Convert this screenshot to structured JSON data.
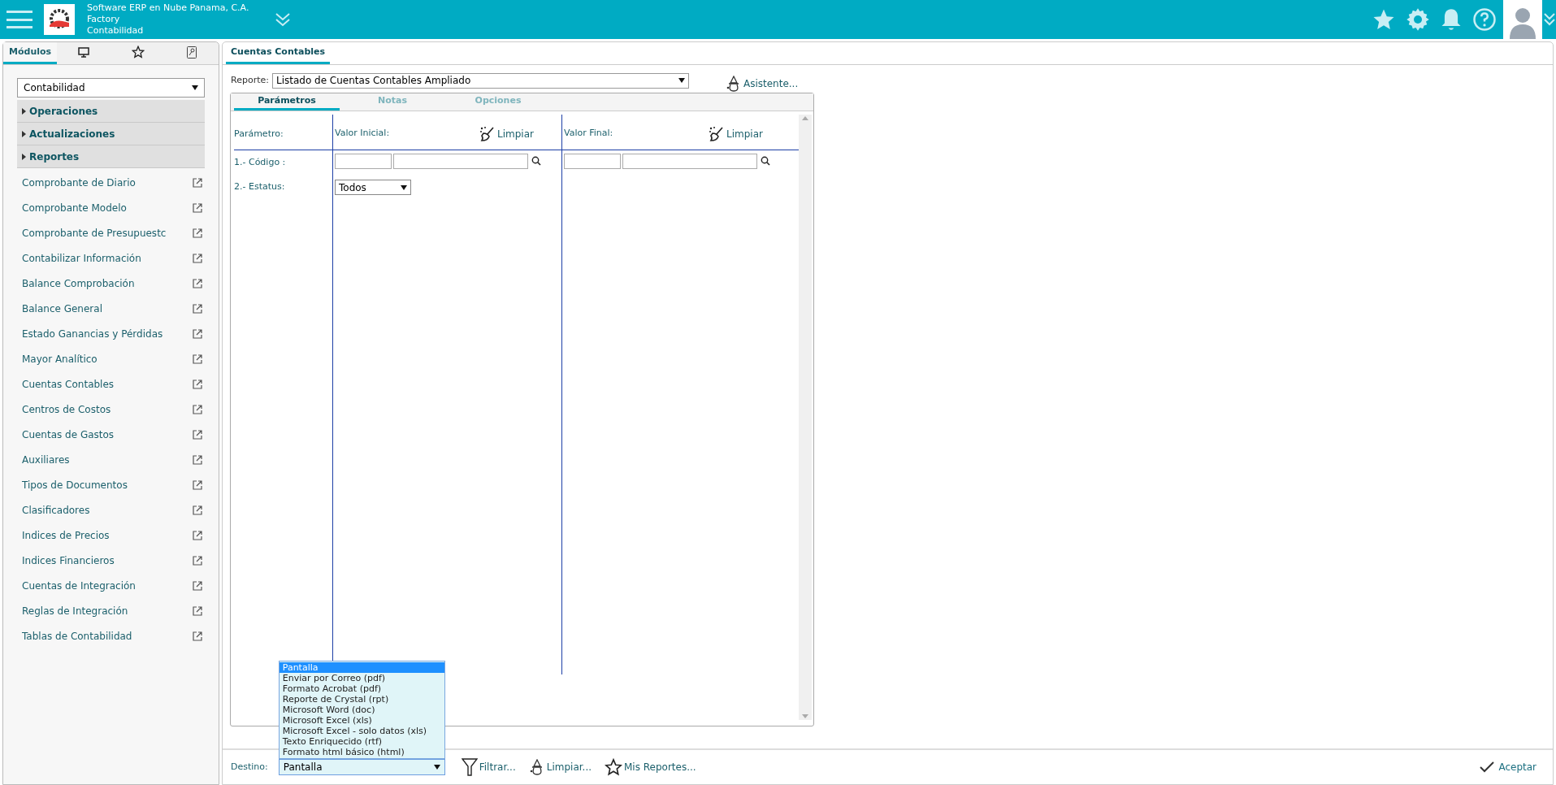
{
  "header": {
    "company_lines": [
      "Software ERP en Nube Panama, C.A.",
      "Factory",
      "Contabilidad"
    ]
  },
  "sidebar": {
    "tabs": [
      {
        "kind": "text",
        "label": "Módulos",
        "selected": true
      },
      {
        "kind": "monitor",
        "selected": false
      },
      {
        "kind": "star",
        "selected": false
      },
      {
        "kind": "key-document",
        "selected": false
      }
    ],
    "module_select": "Contabilidad",
    "sections": [
      {
        "label": "Operaciones",
        "expanded": false
      },
      {
        "label": "Actualizaciones",
        "expanded": false
      },
      {
        "label": "Reportes",
        "expanded": false
      }
    ],
    "items": [
      "Comprobante de Diario",
      "Comprobante Modelo",
      "Comprobante de Presupuestc",
      "Contabilizar Información",
      "Balance Comprobación",
      "Balance General",
      "Estado Ganancias y Pérdidas",
      "Mayor Analítico",
      "Cuentas Contables",
      "Centros de Costos",
      "Cuentas de Gastos",
      "Auxiliares",
      "Tipos de Documentos",
      "Clasificadores",
      "Indices de Precios",
      "Indices Financieros",
      "Cuentas de Integración",
      "Reglas de Integración",
      "Tablas de Contabilidad"
    ]
  },
  "main": {
    "tabs": [
      {
        "label": "Cuentas Contables",
        "selected": true
      }
    ],
    "report": {
      "label": "Reporte:",
      "value": "Listado de Cuentas Contables Ampliado"
    },
    "wizard_button": "Asistente...",
    "inner_tabs": [
      {
        "label": "Parámetros",
        "selected": true
      },
      {
        "label": "Notas",
        "selected": false
      },
      {
        "label": "Opciones",
        "selected": false
      }
    ],
    "param_headers": {
      "parameter": "Parámetro:",
      "initial": "Valor Inicial:",
      "final": "Valor Final:",
      "clear_initial": "Limpiar",
      "clear_final": "Limpiar"
    },
    "params": [
      {
        "kind": "range",
        "label": "1.- Código :"
      },
      {
        "kind": "select",
        "label": "2.- Estatus:",
        "value": "Todos"
      }
    ],
    "destination": {
      "label": "Destino:",
      "value": "Pantalla",
      "options": [
        {
          "label": "Pantalla",
          "selected": true
        },
        {
          "label": "Enviar por Correo (pdf)",
          "selected": false
        },
        {
          "label": "Formato Acrobat (pdf)",
          "selected": false
        },
        {
          "label": "Reporte de Crystal (rpt)",
          "selected": false
        },
        {
          "label": "Microsoft Word (doc)",
          "selected": false
        },
        {
          "label": "Microsoft Excel (xls)",
          "selected": false
        },
        {
          "label": "Microsoft Excel - solo datos (xls)",
          "selected": false
        },
        {
          "label": "Texto Enriquecido (rtf)",
          "selected": false
        },
        {
          "label": "Formato html básico (html)",
          "selected": false
        }
      ]
    },
    "actions": [
      {
        "kind": "filter",
        "label": "Filtrar..."
      },
      {
        "kind": "wizard",
        "label": "Limpiar..."
      },
      {
        "kind": "star",
        "label": "Mis Reportes..."
      }
    ],
    "accept": "Aceptar"
  }
}
